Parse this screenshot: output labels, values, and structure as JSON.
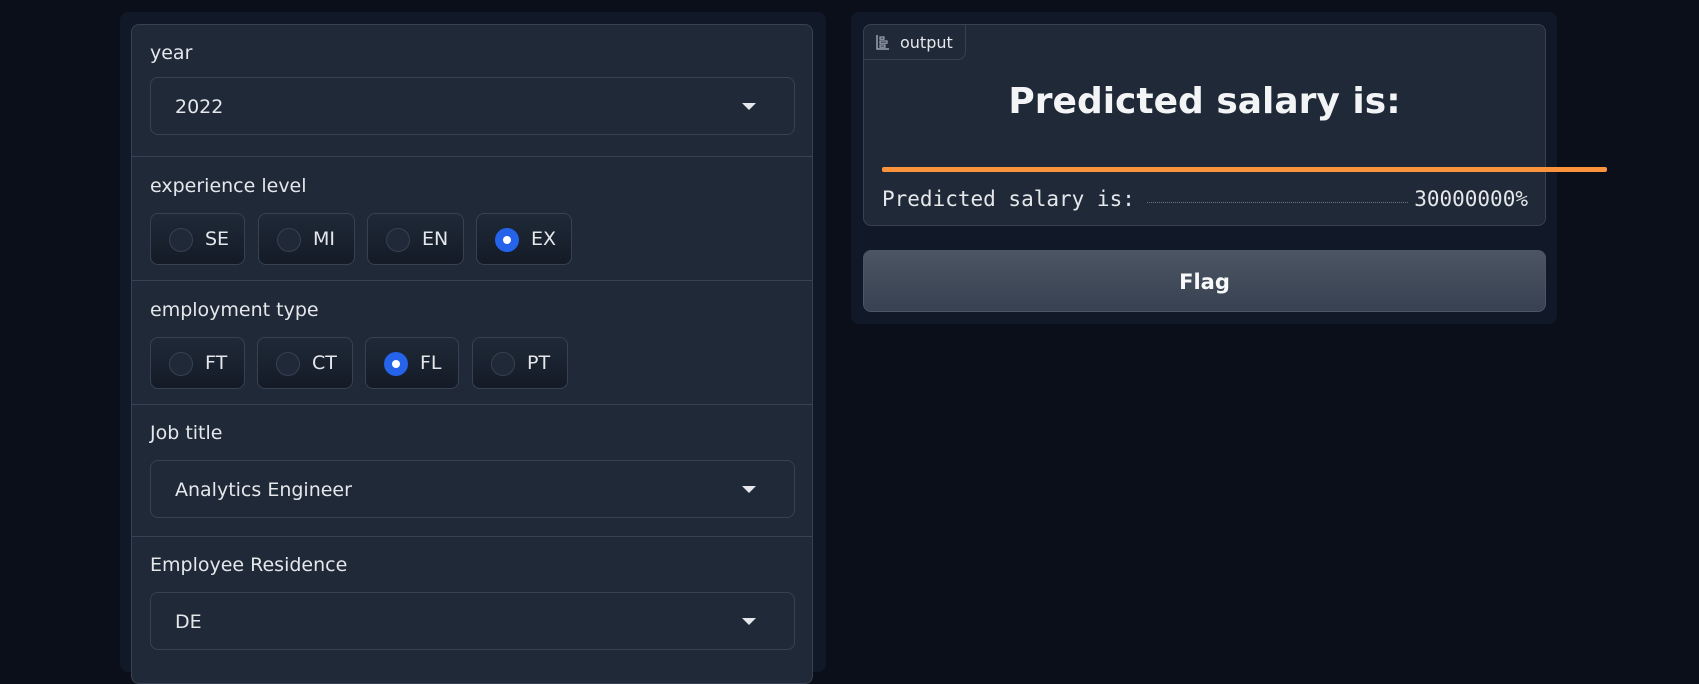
{
  "inputs": {
    "year": {
      "label": "year",
      "value": "2022"
    },
    "experience_level": {
      "label": "experience level",
      "options": [
        "SE",
        "MI",
        "EN",
        "EX"
      ],
      "selected": "EX"
    },
    "employment_type": {
      "label": "employment type",
      "options": [
        "FT",
        "CT",
        "FL",
        "PT"
      ],
      "selected": "FL"
    },
    "job_title": {
      "label": "Job title",
      "value": "Analytics Engineer"
    },
    "employee_residence": {
      "label": "Employee Residence",
      "value": "DE"
    }
  },
  "output": {
    "tag_label": "output",
    "heading": "Predicted salary is:",
    "row_label": "Predicted salary is:",
    "row_value": "30000000%",
    "bar_fraction": 1.0,
    "bar_color": "#fb923c"
  },
  "actions": {
    "flag_label": "Flag"
  },
  "colors": {
    "background": "#0b0f19",
    "panel": "#1f2937",
    "radio_checked": "#2563eb"
  }
}
